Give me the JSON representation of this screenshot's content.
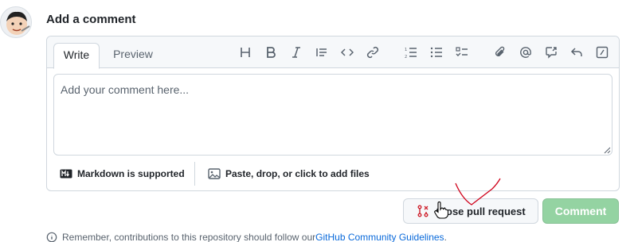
{
  "heading": "Add a comment",
  "tabs": {
    "write": "Write",
    "preview": "Preview"
  },
  "toolbar": [
    "heading-icon",
    "bold-icon",
    "italic-icon",
    "quote-icon",
    "code-icon",
    "link-icon",
    "numbered-list-icon",
    "unordered-list-icon",
    "task-list-icon",
    "attach-icon",
    "mention-icon",
    "cross-reference-icon",
    "reply-icon",
    "slash-commands-icon"
  ],
  "editor": {
    "placeholder": "Add your comment here..."
  },
  "footer": {
    "markdown": "Markdown is supported",
    "attach": "Paste, drop, or click to add files"
  },
  "actions": {
    "close_label": "Close pull request",
    "comment_label": "Comment"
  },
  "note": {
    "text": "Remember, contributions to this repository should follow our ",
    "link": "GitHub Community Guidelines",
    "suffix": "."
  },
  "colors": {
    "comment_button": "#94d3a2",
    "close_icon": "#cf222e",
    "link": "#0969da",
    "annotation": "#d0021b"
  }
}
